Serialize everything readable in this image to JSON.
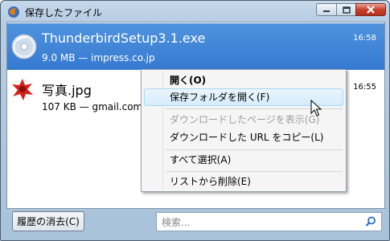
{
  "window": {
    "title": "保存したファイル"
  },
  "downloads": [
    {
      "name": "ThunderbirdSetup3.1.exe",
      "info": "9.0 MB — impress.co.jp",
      "time": "16:58",
      "icon": "cd-icon",
      "selected": true
    },
    {
      "name": "写真.jpg",
      "info": "107 KB — gmail.com:",
      "time": "16:55",
      "icon": "image-file-icon",
      "selected": false
    }
  ],
  "context_menu": {
    "items": [
      {
        "label": "開く(O)",
        "bold": true,
        "disabled": false,
        "hover": false
      },
      {
        "label": "保存フォルダを開く(F)",
        "bold": false,
        "disabled": false,
        "hover": true
      },
      {
        "label": "ダウンロードしたページを表示(G)",
        "bold": false,
        "disabled": true,
        "hover": false
      },
      {
        "label": "ダウンロードした URL をコピー(L)",
        "bold": false,
        "disabled": false,
        "hover": false
      },
      {
        "label": "すべて選択(A)",
        "bold": false,
        "disabled": false,
        "hover": false
      },
      {
        "label": "リストから削除(E)",
        "bold": false,
        "disabled": false,
        "hover": false
      }
    ]
  },
  "bottom": {
    "clear_label": "履歴の消去(C)",
    "search_placeholder": "検索..."
  },
  "colors": {
    "selection": "#3a7fd5",
    "window_frame": "#b7cde3",
    "close_button": "#c8412a"
  }
}
